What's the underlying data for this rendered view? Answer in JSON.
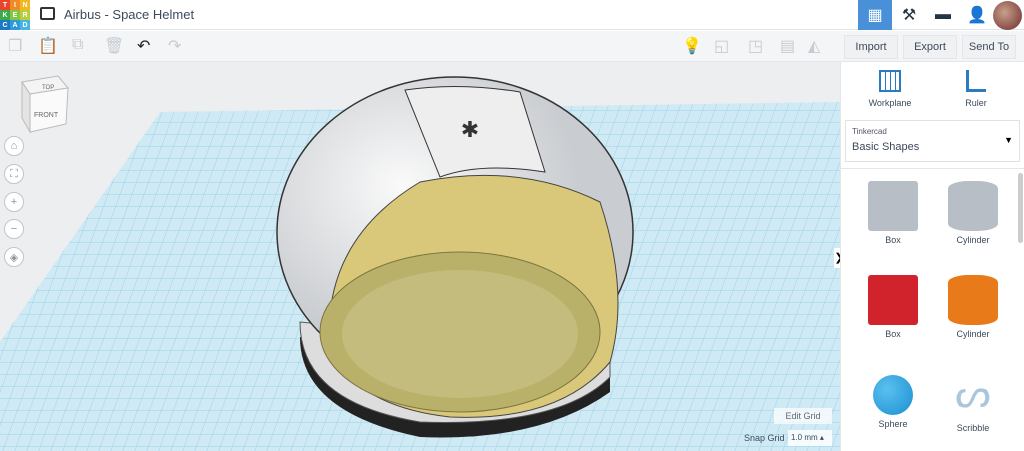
{
  "app": {
    "logo_letters": [
      "T",
      "I",
      "N",
      "K",
      "E",
      "R",
      "C",
      "A",
      "D"
    ],
    "title": "Airbus - Space Helmet"
  },
  "header": {
    "icons": [
      "grid-view-icon",
      "pickaxe-icon",
      "bricks-icon",
      "add-user-icon",
      "avatar"
    ]
  },
  "toolbar": {
    "import": "Import",
    "export": "Export",
    "send_to": "Send To"
  },
  "viewcube": {
    "top": "TOP",
    "front": "FRONT"
  },
  "grid": {
    "edit_grid": "Edit Grid",
    "snap_label": "Snap Grid",
    "snap_value": "1.0 mm"
  },
  "sidebar": {
    "workplane": "Workplane",
    "ruler": "Ruler",
    "library_source": "Tinkercad",
    "library": "Basic Shapes",
    "shapes": [
      {
        "label": "Box",
        "color": "#b8bec6"
      },
      {
        "label": "Cylinder",
        "color": "#b8bec6"
      },
      {
        "label": "Box",
        "color": "#d0232b"
      },
      {
        "label": "Cylinder",
        "color": "#e87a1a"
      },
      {
        "label": "Sphere",
        "color": "#1a8fd1"
      },
      {
        "label": "Scribble",
        "color": "#a9c6dd"
      }
    ]
  }
}
